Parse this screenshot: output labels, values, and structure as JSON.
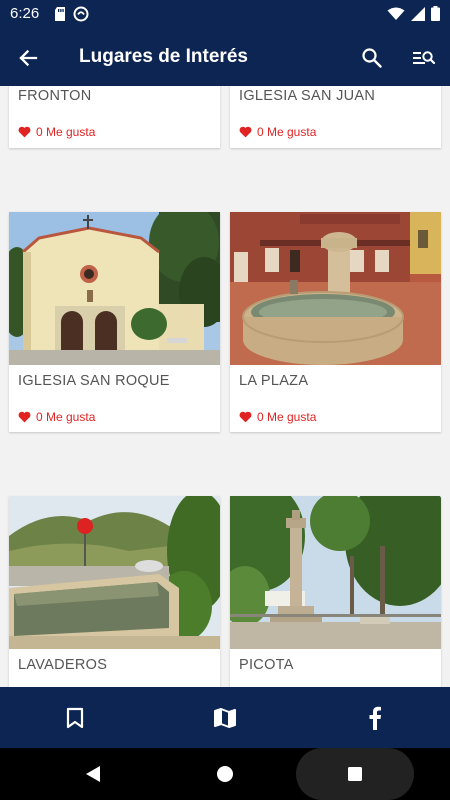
{
  "status_bar": {
    "time": "6:26"
  },
  "app_bar": {
    "title": "Lugares de Interés"
  },
  "cards": [
    {
      "title": "FRONTON",
      "likes": "0 Me gusta"
    },
    {
      "title": "IGLESIA SAN JUAN",
      "likes": "0 Me gusta"
    },
    {
      "title": "IGLESIA SAN ROQUE",
      "likes": "0 Me gusta"
    },
    {
      "title": "LA PLAZA",
      "likes": "0 Me gusta"
    },
    {
      "title": "LAVADEROS"
    },
    {
      "title": "PICOTA"
    }
  ],
  "bottom_nav": {
    "items": [
      {
        "icon": "bookmark-icon"
      },
      {
        "icon": "map-icon"
      },
      {
        "icon": "facebook-icon"
      }
    ]
  },
  "colors": {
    "primary": "#0d2553",
    "like": "#e02424",
    "background": "#f2f2f2"
  }
}
